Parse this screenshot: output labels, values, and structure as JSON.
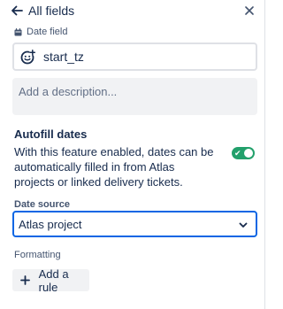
{
  "header": {
    "back_icon": "arrow-left-icon",
    "title": "All fields",
    "close_icon": "close-icon"
  },
  "field": {
    "type_icon": "calendar-icon",
    "type_label": "Date field",
    "name_icon": "emoji-icon",
    "name_value": "start_tz",
    "description_placeholder": "Add a description..."
  },
  "autofill": {
    "heading": "Autofill dates",
    "description": "With this feature enabled, dates can be automatically filled in from Atlas projects or linked delivery tickets.",
    "enabled": true,
    "toggle_color": "#22a06b"
  },
  "date_source": {
    "label": "Date source",
    "selected": "Atlas project",
    "focus_color": "#0c66e4"
  },
  "formatting": {
    "label": "Formatting",
    "add_rule_label": "Add a rule",
    "plus_icon": "plus-icon"
  }
}
